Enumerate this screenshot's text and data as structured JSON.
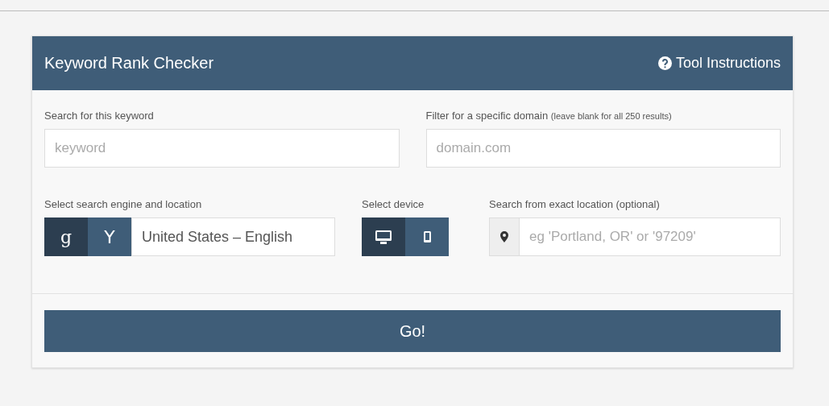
{
  "card": {
    "title": "Keyword Rank Checker",
    "instructions_link": "Tool Instructions"
  },
  "keyword": {
    "label": "Search for this keyword",
    "placeholder": "keyword"
  },
  "domain": {
    "label": "Filter for a specific domain",
    "hint": "(leave blank for all 250 results)",
    "placeholder": "domain.com"
  },
  "engine": {
    "label": "Select search engine and location",
    "options": [
      {
        "kind": "google",
        "glyph": "g",
        "selected": true
      },
      {
        "kind": "yahoo",
        "glyph": "Y",
        "selected": false
      }
    ],
    "location": "United States – English"
  },
  "device": {
    "label": "Select device",
    "options": [
      {
        "kind": "desktop",
        "selected": true
      },
      {
        "kind": "mobile",
        "selected": false
      }
    ]
  },
  "exact_location": {
    "label": "Search from exact location (optional)",
    "placeholder": "eg 'Portland, OR' or '97209'"
  },
  "submit": "Go!"
}
